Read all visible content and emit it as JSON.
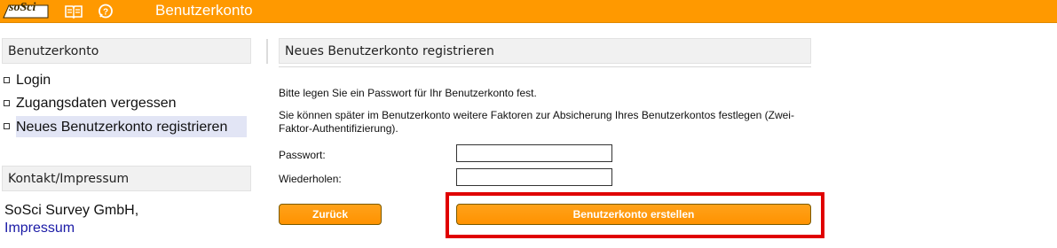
{
  "topbar": {
    "logo_text": "soSci",
    "title": "Benutzerkonto",
    "icons": [
      "manual-book-icon",
      "help-chat-icon"
    ],
    "bar_color": "#ff9900"
  },
  "sidebar": {
    "section_title": "Benutzerkonto",
    "items": [
      {
        "label": "Login",
        "active": false
      },
      {
        "label": "Zugangsdaten vergessen",
        "active": false
      },
      {
        "label": "Neues Benutzerkonto registrieren",
        "active": true
      }
    ],
    "contact_title": "Kontakt/Impressum",
    "company": "SoSci Survey GmbH,",
    "impressum_link": "Impressum"
  },
  "main": {
    "title": "Neues Benutzerkonto registrieren",
    "intro": "Bitte legen Sie ein Passwort für Ihr Benutzerkonto fest.",
    "note": "Sie können später im Benutzerkonto weitere Faktoren zur Absicherung Ihres Benutzerkontos festlegen (Zwei-Faktor-Authentifizierung).",
    "password_label": "Passwort:",
    "password_value": "",
    "repeat_label": "Wiederholen:",
    "repeat_value": "",
    "back_button": "Zurück",
    "create_button": "Benutzerkonto erstellen"
  },
  "colors": {
    "accent": "#ff9900",
    "highlight": "#e00000",
    "link": "#1a1aa6",
    "active_item_bg": "#e2e5f5"
  }
}
